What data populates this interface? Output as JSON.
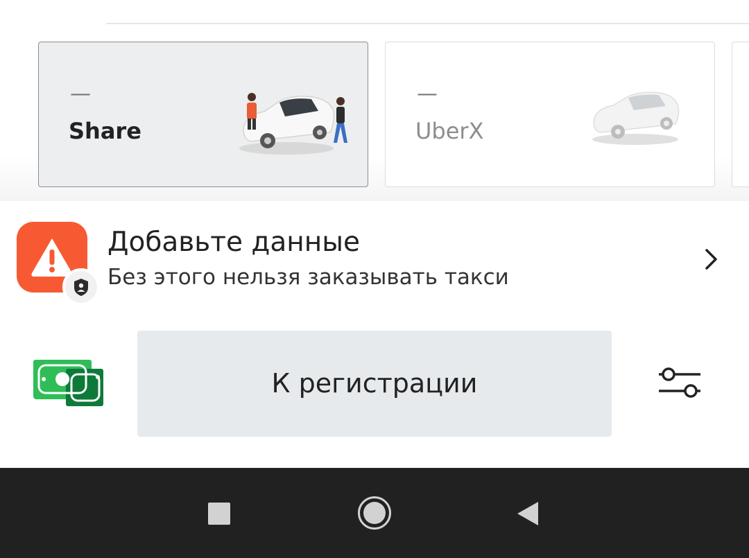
{
  "ride_options": [
    {
      "name": "Share",
      "price": "—",
      "selected": true
    },
    {
      "name": "UberX",
      "price": "—",
      "selected": false
    }
  ],
  "alert": {
    "title": "Добавьте данные",
    "subtitle": "Без этого нельзя заказывать такси",
    "icon": "warning-icon",
    "badge_icon": "shield-icon",
    "accent_color": "#f75a32"
  },
  "actions": {
    "register_label": "К регистрации",
    "payment_icon": "cash-icon",
    "filter_icon": "filter-sliders-icon"
  },
  "system_nav": {
    "recents_icon": "square-icon",
    "home_icon": "circle-icon",
    "back_icon": "triangle-back-icon"
  }
}
